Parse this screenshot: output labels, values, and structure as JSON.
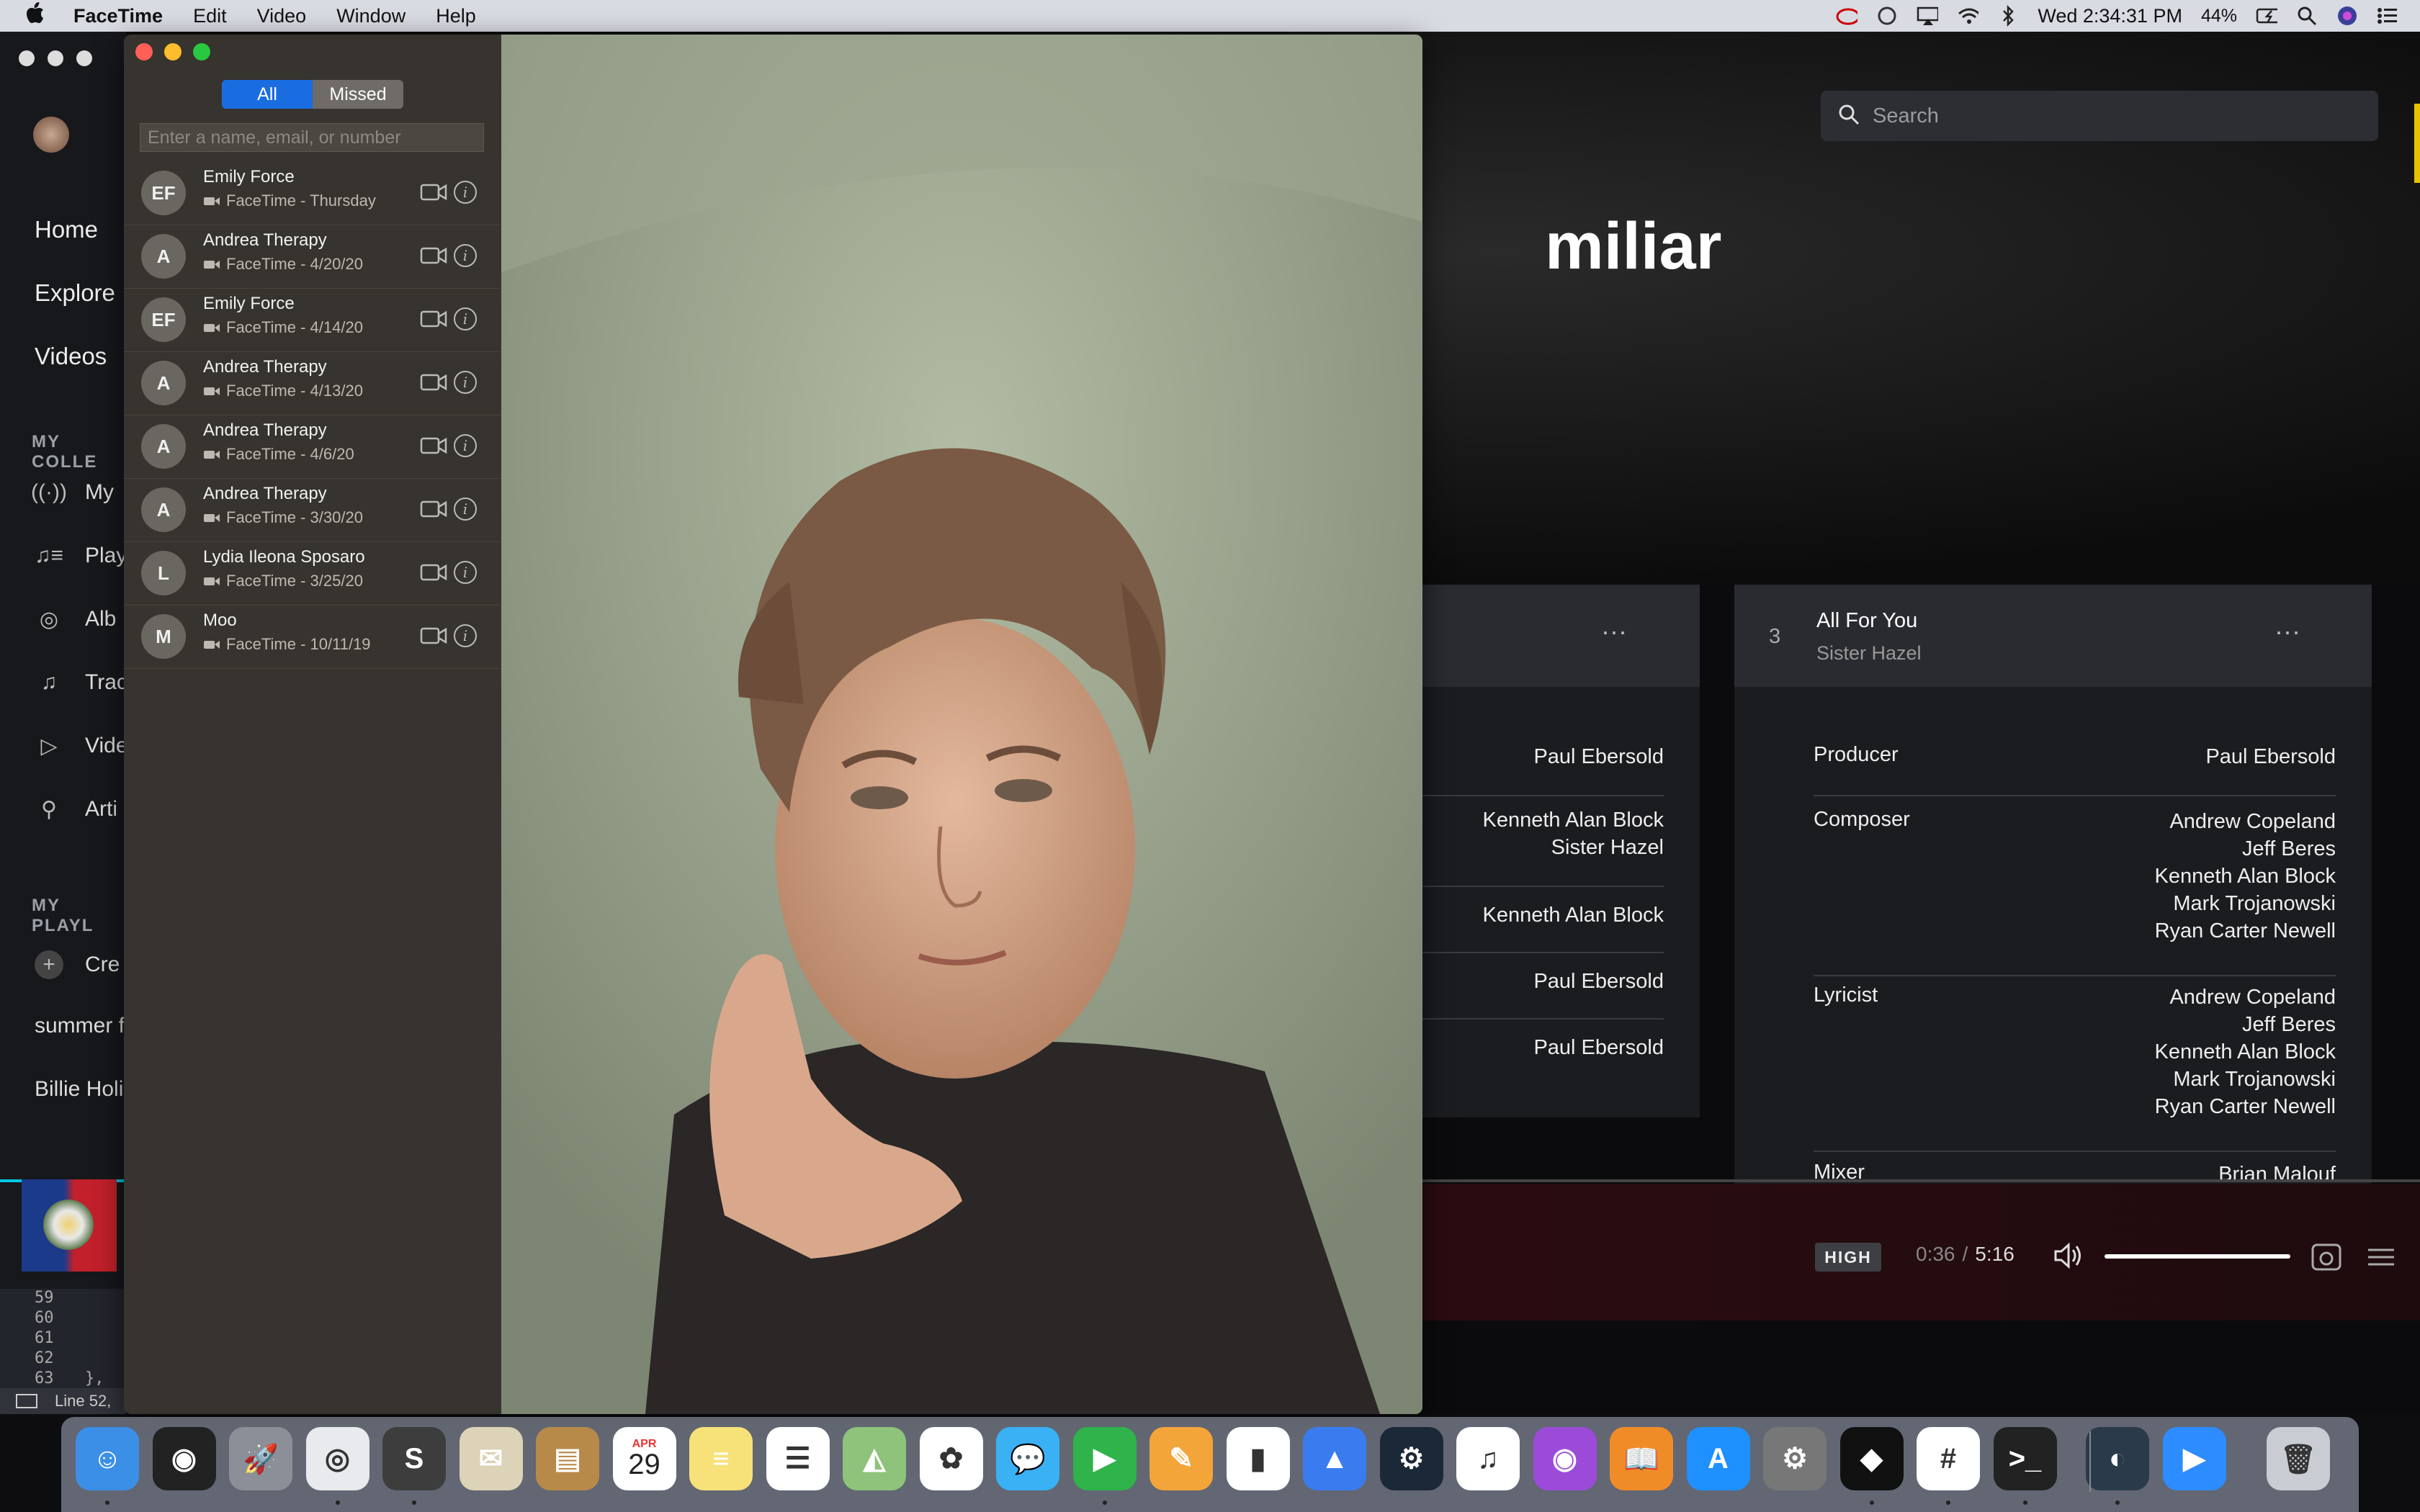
{
  "menubar": {
    "apple": "",
    "app_name": "FaceTime",
    "menus": [
      "Edit",
      "Video",
      "Window",
      "Help"
    ],
    "clock": "Wed 2:34:31 PM",
    "battery": "44%",
    "icons": [
      "creative-cloud-icon",
      "sync-icon",
      "airplay-icon",
      "wifi-icon",
      "bluetooth-icon",
      "battery-icon",
      "search-icon",
      "siri-icon",
      "control-list-icon"
    ]
  },
  "tidal": {
    "nav": [
      "Home",
      "Explore",
      "Videos"
    ],
    "collection_heading": "MY COLLE",
    "collection_items": [
      "My",
      "Play",
      "Alb",
      "Trac",
      "Vide",
      "Arti"
    ],
    "playlists_heading": "MY PLAYL",
    "create_label": "Cre",
    "playlists": [
      "summer f",
      "Billie Holi"
    ],
    "search_placeholder": "Search",
    "hero_title": "miliar",
    "card_left": {
      "rows": [
        {
          "value": "Paul Ebersold"
        },
        {
          "value": "Kenneth Alan Block\nSister Hazel"
        },
        {
          "value": "Kenneth Alan Block"
        },
        {
          "value": "Paul Ebersold"
        },
        {
          "value": "Paul Ebersold"
        }
      ]
    },
    "card_right": {
      "track_number": "3",
      "track_title": "All For You",
      "track_artist": "Sister Hazel",
      "rows": [
        {
          "key": "Producer",
          "value": "Paul Ebersold"
        },
        {
          "key": "Composer",
          "value": "Andrew Copeland\nJeff Beres\nKenneth Alan Block\nMark Trojanowski\nRyan Carter Newell"
        },
        {
          "key": "Lyricist",
          "value": "Andrew Copeland\nJeff Beres\nKenneth Alan Block\nMark Trojanowski\nRyan Carter Newell"
        },
        {
          "key": "Mixer",
          "value": "Brian Malouf"
        }
      ]
    },
    "player": {
      "quality": "HIGH",
      "elapsed": "0:36",
      "separator": "/",
      "duration": "5:16",
      "progress_fraction": 0.11,
      "volume_fraction": 1.0
    },
    "accent": "#00c7e6"
  },
  "editor": {
    "lines": [
      "59",
      "60",
      "61",
      "62",
      "63"
    ],
    "last_code": "},",
    "status": "Line 52,"
  },
  "facetime": {
    "filter_all": "All",
    "filter_missed": "Missed",
    "search_placeholder": "Enter a name, email, or number",
    "calls": [
      {
        "initials": "EF",
        "name": "Emily Force",
        "detail": "FaceTime - Thursday"
      },
      {
        "initials": "A",
        "name": "Andrea Therapy",
        "detail": "FaceTime - 4/20/20"
      },
      {
        "initials": "EF",
        "name": "Emily Force",
        "detail": "FaceTime - 4/14/20"
      },
      {
        "initials": "A",
        "name": "Andrea Therapy",
        "detail": "FaceTime - 4/13/20"
      },
      {
        "initials": "A",
        "name": "Andrea Therapy",
        "detail": "FaceTime - 4/6/20"
      },
      {
        "initials": "A",
        "name": "Andrea Therapy",
        "detail": "FaceTime - 3/30/20"
      },
      {
        "initials": "L",
        "name": "Lydia Ileona Sposaro",
        "detail": "FaceTime - 3/25/20"
      },
      {
        "initials": "M",
        "name": "Moo",
        "detail": "FaceTime - 10/11/19"
      }
    ],
    "accent": "#1a6de0"
  },
  "dock": {
    "apps": [
      "finder",
      "siri",
      "launchpad",
      "chrome",
      "sublime-text",
      "mail-eagle",
      "contacts",
      "calendar",
      "notes",
      "reminders",
      "maps",
      "photos",
      "messages",
      "facetime",
      "pages",
      "numbers",
      "keynote",
      "steam",
      "music",
      "podcasts",
      "books",
      "app-store",
      "system-preferences",
      "tidal",
      "slack",
      "terminal",
      "airvpn",
      "zoom",
      "trash"
    ],
    "calendar_month": "APR",
    "calendar_day": "29"
  }
}
